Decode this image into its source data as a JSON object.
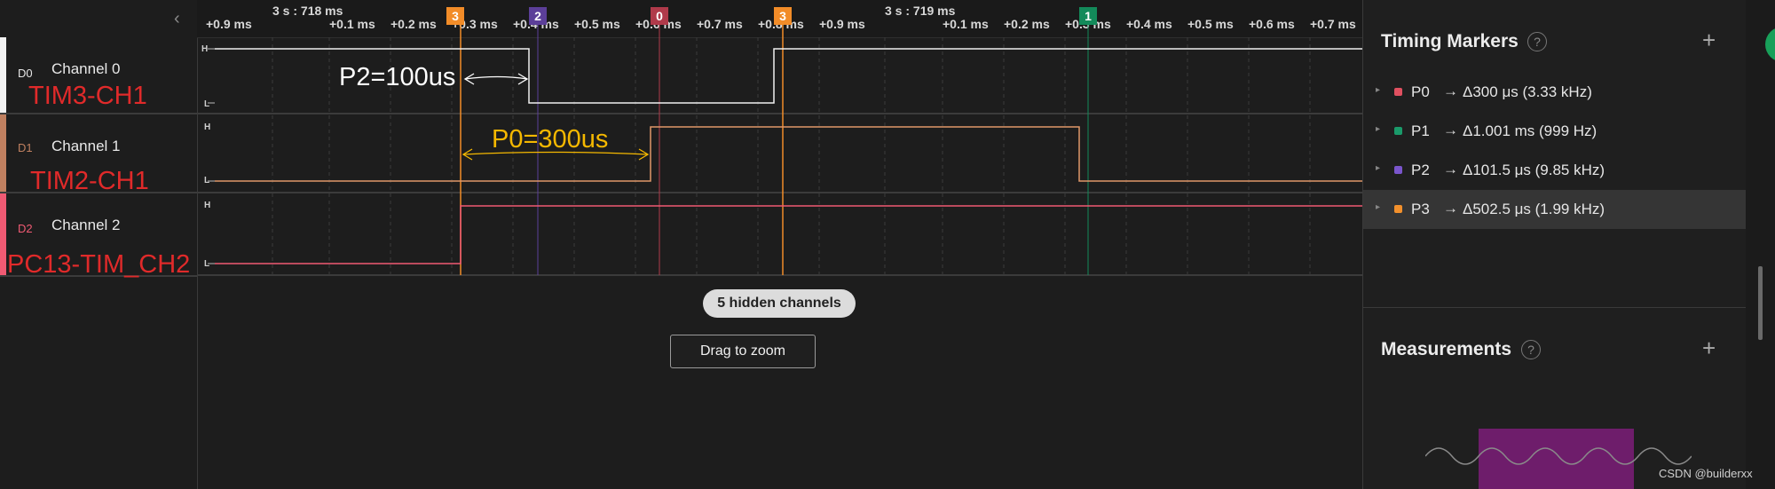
{
  "channels": [
    {
      "code": "D0",
      "name": "Channel 0",
      "annotation": "TIM3-CH1",
      "color": "#f2f2f2"
    },
    {
      "code": "D1",
      "name": "Channel 1",
      "annotation": "TIM2-CH1",
      "color": "#c08060"
    },
    {
      "code": "D2",
      "name": "Channel 2",
      "annotation": "PC13-TIM_CH2",
      "color": "#f05a73"
    }
  ],
  "level_labels": {
    "high": "H",
    "low": "L"
  },
  "ruler": {
    "absolute_labels": [
      "3 s : 718 ms",
      "3 s : 719 ms"
    ],
    "ticks": [
      "+0.9 ms",
      "+0.1 ms",
      "+0.2 ms",
      "+0.3 ms",
      "+0.4 ms",
      "+0.5 ms",
      "+0.6 ms",
      "+0.7 ms",
      "+0.8 ms",
      "+0.9 ms",
      "+0.1 ms",
      "+0.2 ms",
      "+0.3 ms",
      "+0.4 ms",
      "+0.5 ms",
      "+0.6 ms",
      "+0.7 ms"
    ]
  },
  "marker_flags": [
    {
      "label": "3",
      "color": "#f28c28"
    },
    {
      "label": "2",
      "color": "#5c3f99"
    },
    {
      "label": "0",
      "color": "#b03a4a"
    },
    {
      "label": "3",
      "color": "#f28c28"
    },
    {
      "label": "1",
      "color": "#138a5a"
    }
  ],
  "annotations": {
    "p2": "P2=100us",
    "p0": "P0=300us"
  },
  "hidden_channels": "5 hidden channels",
  "zoom_hint": "Drag to zoom",
  "timing_markers": {
    "title": "Timing Markers",
    "items": [
      {
        "name": "P0",
        "value": "Δ300 μs (3.33 kHz)",
        "color": "#e05060",
        "selected": false
      },
      {
        "name": "P1",
        "value": "Δ1.001 ms (999 Hz)",
        "color": "#1a9a6a",
        "selected": false
      },
      {
        "name": "P2",
        "value": "Δ101.5 μs (9.85 kHz)",
        "color": "#7a55cc",
        "selected": false
      },
      {
        "name": "P3",
        "value": "Δ502.5 μs (1.99 kHz)",
        "color": "#f2902c",
        "selected": true
      }
    ]
  },
  "measurements": {
    "title": "Measurements"
  },
  "icons": {
    "help": "?",
    "add": "+",
    "collapse": "‹",
    "arrow": "→",
    "caret": "▸"
  },
  "watermark": "CSDN @builderxx"
}
